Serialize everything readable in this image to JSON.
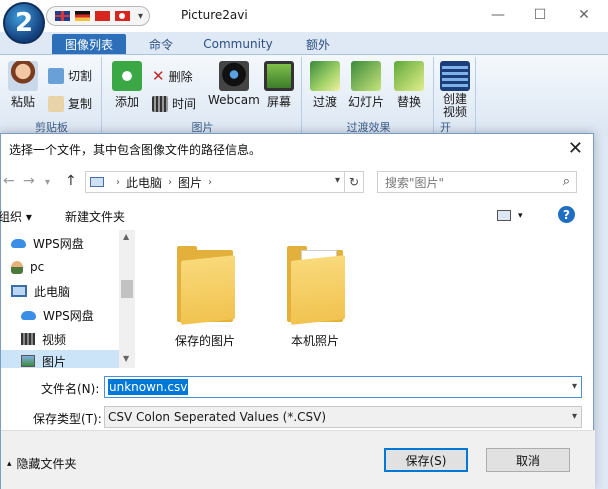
{
  "app": {
    "title": "Picture2avi",
    "logo_text": "2",
    "window_controls": {
      "minimize": "—",
      "maximize": "☐",
      "close": "✕"
    }
  },
  "ribbon": {
    "tabs": [
      {
        "label": "图像列表",
        "active": true
      },
      {
        "label": "命令",
        "active": false
      },
      {
        "label": "Community",
        "active": false
      },
      {
        "label": "额外",
        "active": false
      }
    ],
    "groups": {
      "clipboard": {
        "label": "剪贴板",
        "paste": "粘贴",
        "cut": "切割",
        "copy": "复制"
      },
      "pictures": {
        "label": "图片",
        "add": "添加",
        "delete": "删除",
        "time": "时间",
        "webcam": "Webcam",
        "screen": "屏幕"
      },
      "transitions": {
        "label": "过渡效果",
        "transition": "过渡",
        "slideshow": "幻灯片",
        "replace": "替换"
      },
      "video": {
        "label": "开",
        "create": "创建",
        "create2": "视频"
      }
    }
  },
  "dialog": {
    "title": "选择一个文件，其中包含图像文件的路径信息。",
    "close": "✕",
    "address": {
      "part1": "此电脑",
      "part2": "图片"
    },
    "search_placeholder": "搜索\"图片\"",
    "toolbar": {
      "organize": "组织 ▾",
      "new_folder": "新建文件夹",
      "help": "?"
    },
    "tree": [
      {
        "label": "WPS网盘",
        "icon": "cloud-icon"
      },
      {
        "label": "pc",
        "icon": "user-icon"
      },
      {
        "label": "此电脑",
        "icon": "computer-icon"
      },
      {
        "label": "WPS网盘",
        "icon": "cloud-icon"
      },
      {
        "label": "视频",
        "icon": "video-icon"
      },
      {
        "label": "图片",
        "icon": "pictures-icon",
        "selected": true
      }
    ],
    "folders": [
      {
        "label": "保存的图片"
      },
      {
        "label": "本机照片"
      }
    ],
    "filename_label": "文件名(N):",
    "filename_value": "unknown.csv",
    "filetype_label": "保存类型(T):",
    "filetype_value": "CSV Colon Seperated Values (*.CSV)",
    "hide_folders": "隐藏文件夹",
    "save_button": "保存(S)",
    "cancel_button": "取消"
  },
  "colors": {
    "ribbon_tab_active": "#2d6fb8",
    "selection": "#0078d7",
    "folder": "#f1c350"
  }
}
